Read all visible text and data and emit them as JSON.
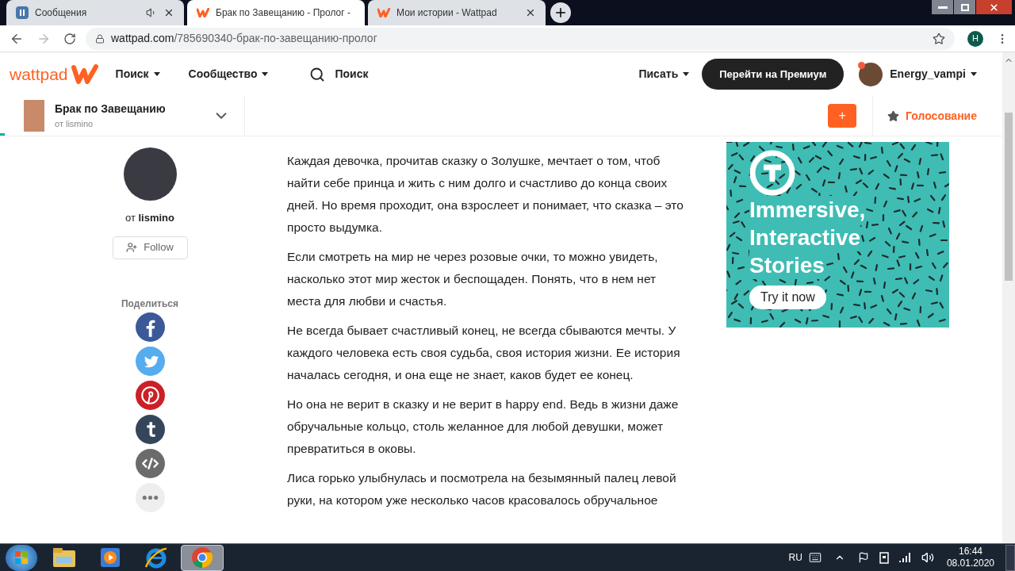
{
  "browser": {
    "tabs": [
      {
        "title": "Сообщения",
        "kind": "messages",
        "selected": false,
        "audio": true
      },
      {
        "title": "Брак по Завещанию - Пролог -",
        "kind": "wattpad",
        "selected": true,
        "audio": false
      },
      {
        "title": "Мои истории - Wattpad",
        "kind": "wattpad",
        "selected": false,
        "audio": false
      }
    ],
    "url_host": "wattpad.com",
    "url_path": "/785690340-брак-по-завещанию-пролог",
    "profile_initial": "H"
  },
  "header": {
    "logo": "wattpad",
    "nav": [
      "Поиск",
      "Сообщество"
    ],
    "search": "Поиск",
    "write": "Писать",
    "premium": "Перейти на Премиум",
    "username": "Energy_vampi",
    "notification": true
  },
  "story_bar": {
    "title": "Брак по Завещанию",
    "author": "от lismino",
    "add": "+",
    "vote": "Голосование",
    "reading_progress": {
      "level": 0.005
    }
  },
  "author": {
    "prefix": "от",
    "name": "lismino",
    "follow": "Follow"
  },
  "share": {
    "label": "Поделиться",
    "items": [
      {
        "kind": "facebook"
      },
      {
        "kind": "twitter"
      },
      {
        "kind": "pinterest"
      },
      {
        "kind": "tumblr"
      },
      {
        "kind": "embed"
      },
      {
        "kind": "more"
      }
    ]
  },
  "paragraphs": [
    "Каждая девочка, прочитав сказку о Золушке, мечтает о том, чтоб найти себе принца и жить с ним долго и счастливо до конца своих дней. Но время проходит, она взрослеет и понимает, что сказка – это просто выдумка.",
    "Если смотреть на мир не через розовые очки, то можно увидеть, насколько этот мир жесток и беспощаден. Понять, что в нем нет места для любви и счастья.",
    "Не всегда бывает счастливый конец, не всегда сбываются мечты. У каждого человека есть своя судьба, своя история жизни. Ее история началась сегодня, и она еще не знает, каков будет ее конец.",
    "Но она не верит в сказку и не верит в happy end. Ведь в жизни даже обручальные кольцо, столь желанное для любой девушки, может превратиться в оковы.",
    "Лиса горько улыбнулась и посмотрела на безымянный палец левой руки, на котором уже несколько часов красовалось обручальное"
  ],
  "ad": {
    "headline": [
      "Immersive,",
      "Interactive",
      "Stories"
    ],
    "cta": "Try it now"
  },
  "taskbar": {
    "apps": [
      {
        "kind": "explorer",
        "selected": false
      },
      {
        "kind": "media",
        "selected": false
      },
      {
        "kind": "ie",
        "selected": false
      },
      {
        "kind": "chrome",
        "selected": true
      }
    ],
    "language": "RU",
    "time": "16:44",
    "date": "08.01.2020"
  }
}
